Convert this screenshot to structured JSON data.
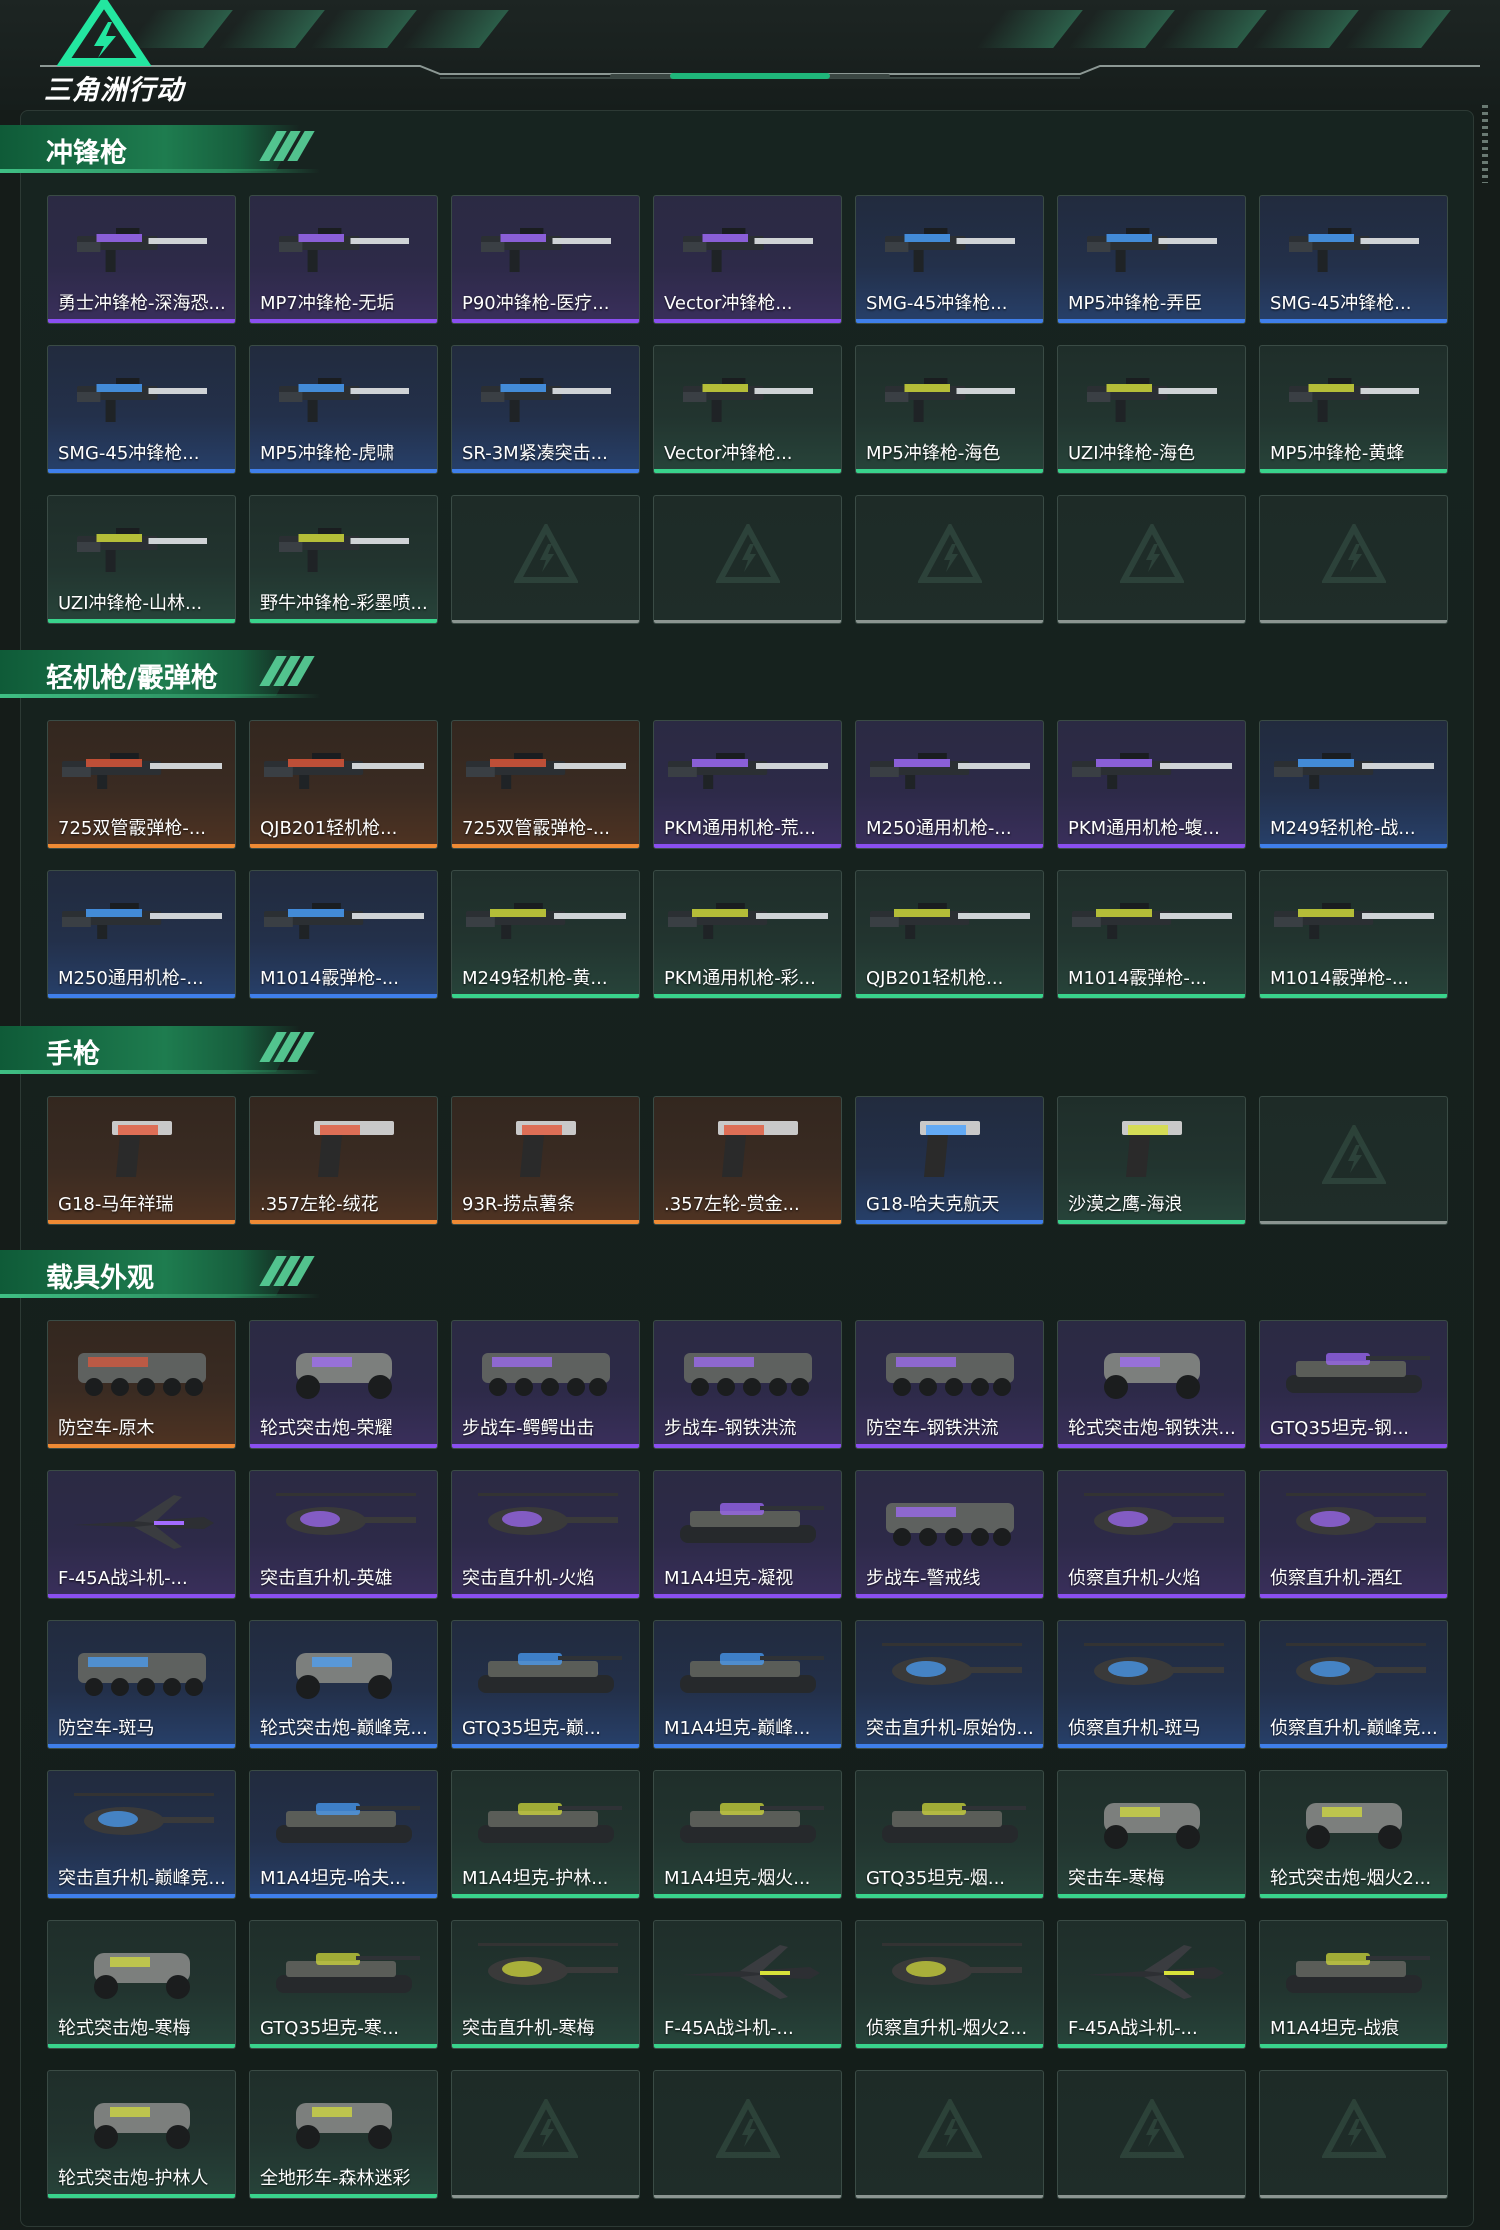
{
  "header": {
    "logo_text": "三角洲行动"
  },
  "sections": [
    {
      "title": "冲锋枪",
      "items": [
        {
          "label": "勇士冲锋枪-深海恐...",
          "rarity": "purple",
          "icon": "smg-icon"
        },
        {
          "label": "MP7冲锋枪-无垢",
          "rarity": "purple",
          "icon": "smg-icon"
        },
        {
          "label": "P90冲锋枪-医疗...",
          "rarity": "purple",
          "icon": "smg-icon"
        },
        {
          "label": "Vector冲锋枪...",
          "rarity": "purple",
          "icon": "smg-icon"
        },
        {
          "label": "SMG-45冲锋枪...",
          "rarity": "blue",
          "icon": "smg-icon"
        },
        {
          "label": "MP5冲锋枪-弄臣",
          "rarity": "blue",
          "icon": "smg-icon"
        },
        {
          "label": "SMG-45冲锋枪...",
          "rarity": "blue",
          "icon": "smg-icon"
        },
        {
          "label": "SMG-45冲锋枪...",
          "rarity": "blue",
          "icon": "smg-icon"
        },
        {
          "label": "MP5冲锋枪-虎啸",
          "rarity": "blue",
          "icon": "smg-icon"
        },
        {
          "label": "SR-3M紧凑突击...",
          "rarity": "blue",
          "icon": "smg-icon"
        },
        {
          "label": "Vector冲锋枪...",
          "rarity": "green",
          "icon": "smg-icon"
        },
        {
          "label": "MP5冲锋枪-海色",
          "rarity": "green",
          "icon": "smg-icon"
        },
        {
          "label": "UZI冲锋枪-海色",
          "rarity": "green",
          "icon": "smg-icon"
        },
        {
          "label": "MP5冲锋枪-黄蜂",
          "rarity": "green",
          "icon": "smg-icon"
        },
        {
          "label": "UZI冲锋枪-山林...",
          "rarity": "green",
          "icon": "smg-icon"
        },
        {
          "label": "野牛冲锋枪-彩墨喷...",
          "rarity": "green",
          "icon": "smg-icon"
        },
        {
          "label": "",
          "rarity": "empty"
        },
        {
          "label": "",
          "rarity": "empty"
        },
        {
          "label": "",
          "rarity": "empty"
        },
        {
          "label": "",
          "rarity": "empty"
        },
        {
          "label": "",
          "rarity": "empty"
        }
      ]
    },
    {
      "title": "轻机枪/霰弹枪",
      "items": [
        {
          "label": "725双管霰弹枪-...",
          "rarity": "orange",
          "icon": "shotgun-icon"
        },
        {
          "label": "QJB201轻机枪...",
          "rarity": "orange",
          "icon": "lmg-icon"
        },
        {
          "label": "725双管霰弹枪-...",
          "rarity": "orange",
          "icon": "shotgun-icon"
        },
        {
          "label": "PKM通用机枪-荒...",
          "rarity": "purple",
          "icon": "lmg-icon"
        },
        {
          "label": "M250通用机枪-...",
          "rarity": "purple",
          "icon": "lmg-icon"
        },
        {
          "label": "PKM通用机枪-蝮...",
          "rarity": "purple",
          "icon": "lmg-icon"
        },
        {
          "label": "M249轻机枪-战...",
          "rarity": "blue",
          "icon": "lmg-icon"
        },
        {
          "label": "M250通用机枪-...",
          "rarity": "blue",
          "icon": "lmg-icon"
        },
        {
          "label": "M1014霰弹枪-...",
          "rarity": "blue",
          "icon": "shotgun-icon"
        },
        {
          "label": "M249轻机枪-黄...",
          "rarity": "green",
          "icon": "lmg-icon"
        },
        {
          "label": "PKM通用机枪-彩...",
          "rarity": "green",
          "icon": "lmg-icon"
        },
        {
          "label": "QJB201轻机枪...",
          "rarity": "green",
          "icon": "lmg-icon"
        },
        {
          "label": "M1014霰弹枪-...",
          "rarity": "green",
          "icon": "shotgun-icon"
        },
        {
          "label": "M1014霰弹枪-...",
          "rarity": "green",
          "icon": "shotgun-icon"
        }
      ]
    },
    {
      "title": "手枪",
      "items": [
        {
          "label": "G18-马年祥瑞",
          "rarity": "orange",
          "icon": "pistol-icon"
        },
        {
          "label": ".357左轮-绒花",
          "rarity": "orange",
          "icon": "revolver-icon"
        },
        {
          "label": "93R-捞点薯条",
          "rarity": "orange",
          "icon": "pistol-icon"
        },
        {
          "label": ".357左轮-赏金...",
          "rarity": "orange",
          "icon": "revolver-icon"
        },
        {
          "label": "G18-哈夫克航天",
          "rarity": "blue",
          "icon": "pistol-icon"
        },
        {
          "label": "沙漠之鹰-海浪",
          "rarity": "green",
          "icon": "pistol-icon"
        },
        {
          "label": "",
          "rarity": "empty"
        }
      ]
    },
    {
      "title": "载具外观",
      "items": [
        {
          "label": "防空车-原木",
          "rarity": "orange",
          "icon": "apc-icon"
        },
        {
          "label": "轮式突击炮-荣耀",
          "rarity": "purple",
          "icon": "buggy-icon"
        },
        {
          "label": "步战车-鳄鳄出击",
          "rarity": "purple",
          "icon": "apc-icon"
        },
        {
          "label": "步战车-钢铁洪流",
          "rarity": "purple",
          "icon": "apc-icon"
        },
        {
          "label": "防空车-钢铁洪流",
          "rarity": "purple",
          "icon": "apc-icon"
        },
        {
          "label": "轮式突击炮-钢铁洪...",
          "rarity": "purple",
          "icon": "buggy-icon"
        },
        {
          "label": "GTQ35坦克-钢...",
          "rarity": "purple",
          "icon": "tank-icon"
        },
        {
          "label": "F-45A战斗机-...",
          "rarity": "purple",
          "icon": "jet-icon"
        },
        {
          "label": "突击直升机-英雄",
          "rarity": "purple",
          "icon": "helicopter-icon"
        },
        {
          "label": "突击直升机-火焰",
          "rarity": "purple",
          "icon": "helicopter-icon"
        },
        {
          "label": "M1A4坦克-凝视",
          "rarity": "purple",
          "icon": "tank-icon"
        },
        {
          "label": "步战车-警戒线",
          "rarity": "purple",
          "icon": "apc-icon"
        },
        {
          "label": "侦察直升机-火焰",
          "rarity": "purple",
          "icon": "helicopter-icon"
        },
        {
          "label": "侦察直升机-酒红",
          "rarity": "purple",
          "icon": "helicopter-icon"
        },
        {
          "label": "防空车-斑马",
          "rarity": "blue",
          "icon": "apc-icon"
        },
        {
          "label": "轮式突击炮-巅峰竞...",
          "rarity": "blue",
          "icon": "buggy-icon"
        },
        {
          "label": "GTQ35坦克-巅...",
          "rarity": "blue",
          "icon": "tank-icon"
        },
        {
          "label": "M1A4坦克-巅峰...",
          "rarity": "blue",
          "icon": "tank-icon"
        },
        {
          "label": "突击直升机-原始伪...",
          "rarity": "blue",
          "icon": "helicopter-icon"
        },
        {
          "label": "侦察直升机-斑马",
          "rarity": "blue",
          "icon": "helicopter-icon"
        },
        {
          "label": "侦察直升机-巅峰竞...",
          "rarity": "blue",
          "icon": "helicopter-icon"
        },
        {
          "label": "突击直升机-巅峰竞...",
          "rarity": "blue",
          "icon": "helicopter-icon"
        },
        {
          "label": "M1A4坦克-哈夫...",
          "rarity": "blue",
          "icon": "tank-icon"
        },
        {
          "label": "M1A4坦克-护林...",
          "rarity": "green",
          "icon": "tank-icon"
        },
        {
          "label": "M1A4坦克-烟火...",
          "rarity": "green",
          "icon": "tank-icon"
        },
        {
          "label": "GTQ35坦克-烟...",
          "rarity": "green",
          "icon": "tank-icon"
        },
        {
          "label": "突击车-寒梅",
          "rarity": "green",
          "icon": "buggy-icon"
        },
        {
          "label": "轮式突击炮-烟火2...",
          "rarity": "green",
          "icon": "buggy-icon"
        },
        {
          "label": "轮式突击炮-寒梅",
          "rarity": "green",
          "icon": "buggy-icon"
        },
        {
          "label": "GTQ35坦克-寒...",
          "rarity": "green",
          "icon": "tank-icon"
        },
        {
          "label": "突击直升机-寒梅",
          "rarity": "green",
          "icon": "helicopter-icon"
        },
        {
          "label": "F-45A战斗机-...",
          "rarity": "green",
          "icon": "jet-icon"
        },
        {
          "label": "侦察直升机-烟火2...",
          "rarity": "green",
          "icon": "helicopter-icon"
        },
        {
          "label": "F-45A战斗机-...",
          "rarity": "green",
          "icon": "jet-icon"
        },
        {
          "label": "M1A4坦克-战痕",
          "rarity": "green",
          "icon": "tank-icon"
        },
        {
          "label": "轮式突击炮-护林人",
          "rarity": "green",
          "icon": "buggy-icon"
        },
        {
          "label": "全地形车-森林迷彩",
          "rarity": "green",
          "icon": "atv-icon"
        },
        {
          "label": "",
          "rarity": "empty"
        },
        {
          "label": "",
          "rarity": "empty"
        },
        {
          "label": "",
          "rarity": "empty"
        },
        {
          "label": "",
          "rarity": "empty"
        },
        {
          "label": "",
          "rarity": "empty"
        }
      ]
    }
  ],
  "colors": {
    "purple": "#8a4ff0",
    "blue": "#3f7fea",
    "orange": "#ef8a34",
    "green": "#39d38c",
    "accent": "#1e7c4f"
  }
}
